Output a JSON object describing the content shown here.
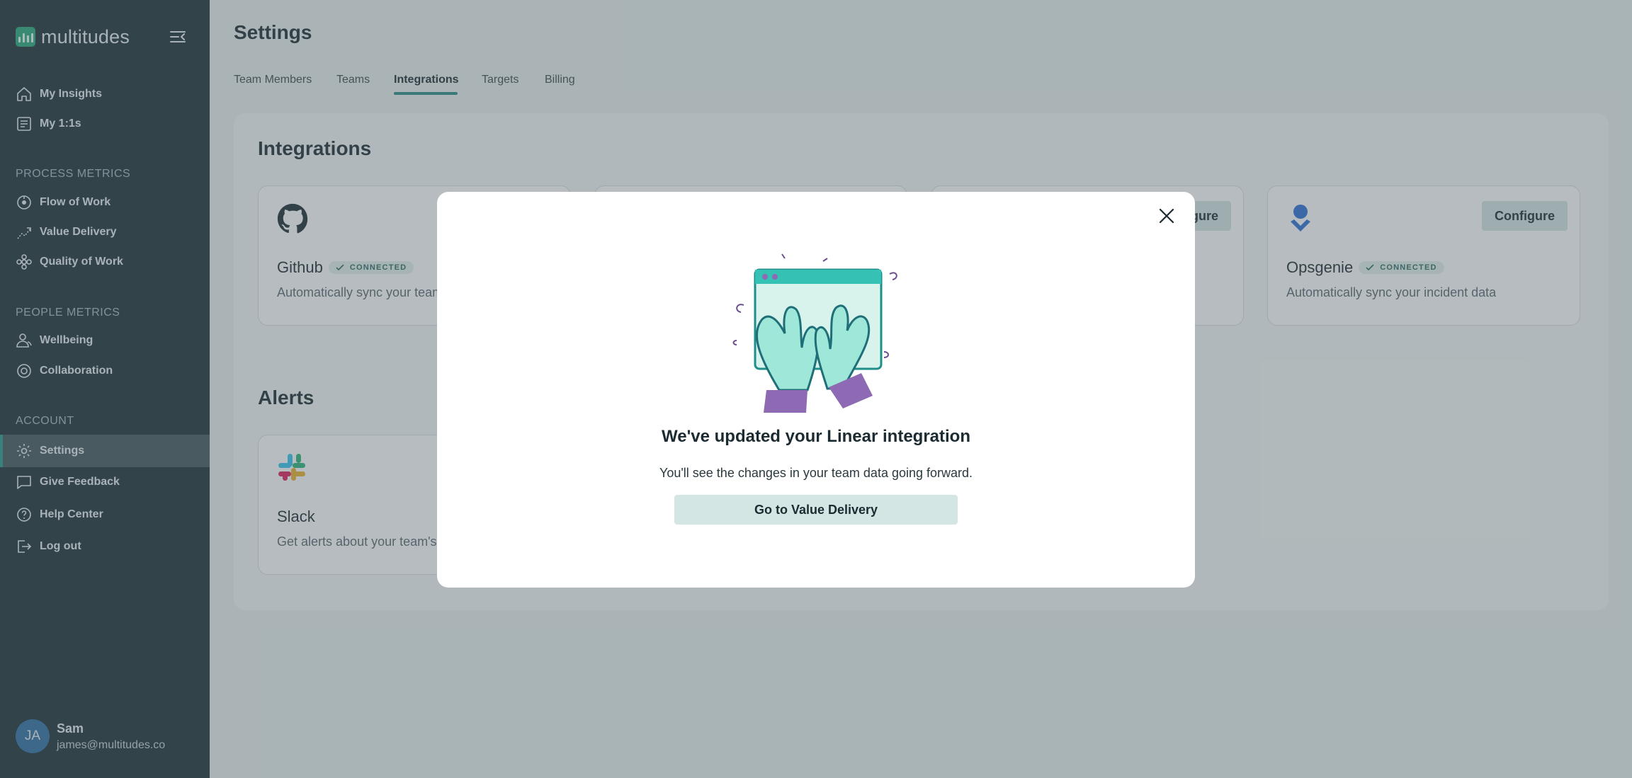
{
  "app": {
    "name": "multitudes"
  },
  "sidebar": {
    "top_items": [
      {
        "label": "My Insights",
        "icon": "home-icon"
      },
      {
        "label": "My 1:1s",
        "icon": "notes-icon"
      }
    ],
    "process_label": "PROCESS METRICS",
    "process_items": [
      {
        "label": "Flow of Work",
        "icon": "flow-icon"
      },
      {
        "label": "Value Delivery",
        "icon": "trend-icon"
      },
      {
        "label": "Quality of Work",
        "icon": "quality-icon"
      }
    ],
    "people_label": "PEOPLE METRICS",
    "people_items": [
      {
        "label": "Wellbeing",
        "icon": "wellbeing-icon"
      },
      {
        "label": "Collaboration",
        "icon": "collaboration-icon"
      }
    ],
    "account_label": "ACCOUNT",
    "account_items": [
      {
        "label": "Settings",
        "icon": "gear-icon",
        "active": true
      },
      {
        "label": "Give Feedback",
        "icon": "chat-icon"
      },
      {
        "label": "Help Center",
        "icon": "help-icon"
      },
      {
        "label": "Log out",
        "icon": "logout-icon"
      }
    ],
    "user": {
      "initials": "JA",
      "name": "Sam",
      "email": "james@multitudes.co"
    }
  },
  "page": {
    "title": "Settings",
    "tabs": [
      {
        "label": "Team Members"
      },
      {
        "label": "Teams"
      },
      {
        "label": "Integrations",
        "active": true
      },
      {
        "label": "Targets"
      },
      {
        "label": "Billing"
      }
    ]
  },
  "integrations": {
    "title": "Integrations",
    "cards": [
      {
        "name": "Github",
        "status": "CONNECTED",
        "description": "Automatically sync your team"
      },
      {
        "configure_label": "Configure"
      },
      {
        "name": "Opsgenie",
        "status": "CONNECTED",
        "description": "Automatically sync your incident data",
        "configure_label": "Configure"
      }
    ]
  },
  "alerts": {
    "title": "Alerts",
    "cards": [
      {
        "name": "Slack",
        "description": "Get alerts about your team's"
      }
    ]
  },
  "modal": {
    "title": "We've updated your Linear integration",
    "text": "You'll see the changes in your team data going forward.",
    "cta": "Go to Value Delivery"
  },
  "colors": {
    "sidebar": "#1c2f36",
    "accent": "#2a8c84",
    "cta": "#d4e6e4",
    "avatar": "#2f6fa2"
  }
}
